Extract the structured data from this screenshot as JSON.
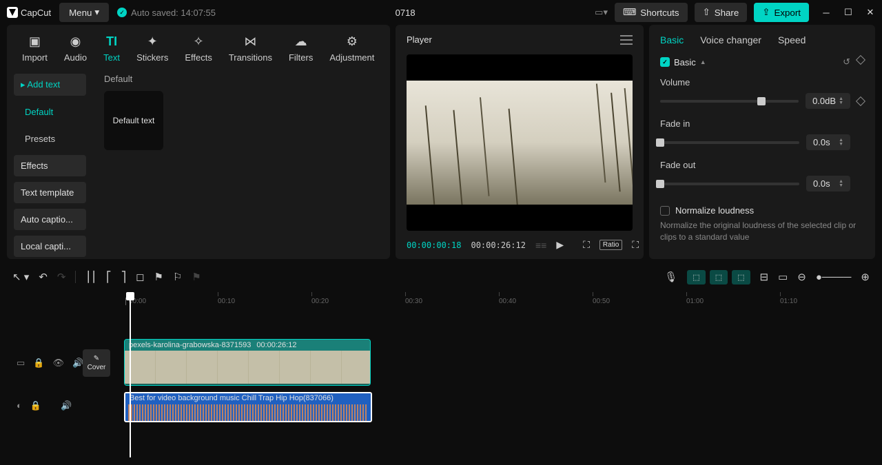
{
  "app": {
    "name": "CapCut",
    "menu_label": "Menu",
    "autosave": "Auto saved: 14:07:55",
    "project_title": "0718"
  },
  "titlebar": {
    "shortcuts": "Shortcuts",
    "share": "Share",
    "export": "Export"
  },
  "top_tabs": [
    "Import",
    "Audio",
    "Text",
    "Stickers",
    "Effects",
    "Transitions",
    "Filters",
    "Adjustment"
  ],
  "sidebar": {
    "add_text": "Add text",
    "default": "Default",
    "presets": "Presets",
    "effects": "Effects",
    "text_template": "Text template",
    "auto_captions": "Auto captio...",
    "local_captions": "Local capti..."
  },
  "content": {
    "heading": "Default",
    "preset_label": "Default text"
  },
  "player": {
    "title": "Player",
    "current_time": "00:00:00:18",
    "total_time": "00:00:26:12",
    "ratio": "Ratio"
  },
  "inspector": {
    "tabs": {
      "basic": "Basic",
      "voice_changer": "Voice changer",
      "speed": "Speed"
    },
    "section_label": "Basic",
    "volume": {
      "label": "Volume",
      "value": "0.0dB"
    },
    "fade_in": {
      "label": "Fade in",
      "value": "0.0s"
    },
    "fade_out": {
      "label": "Fade out",
      "value": "0.0s"
    },
    "normalize": {
      "label": "Normalize loudness",
      "desc": "Normalize the original loudness of the selected clip or clips to a standard value"
    }
  },
  "timeline": {
    "cover": "Cover",
    "ruler": [
      "00:00",
      "00:10",
      "00:20",
      "00:30",
      "00:40",
      "00:50",
      "01:00",
      "01:10"
    ],
    "video_clip": {
      "name": "pexels-karolina-grabowska-8371593",
      "duration": "00:00:26:12"
    },
    "audio_clip": {
      "name": "Best for video background music Chill Trap Hip Hop(837066)"
    }
  }
}
